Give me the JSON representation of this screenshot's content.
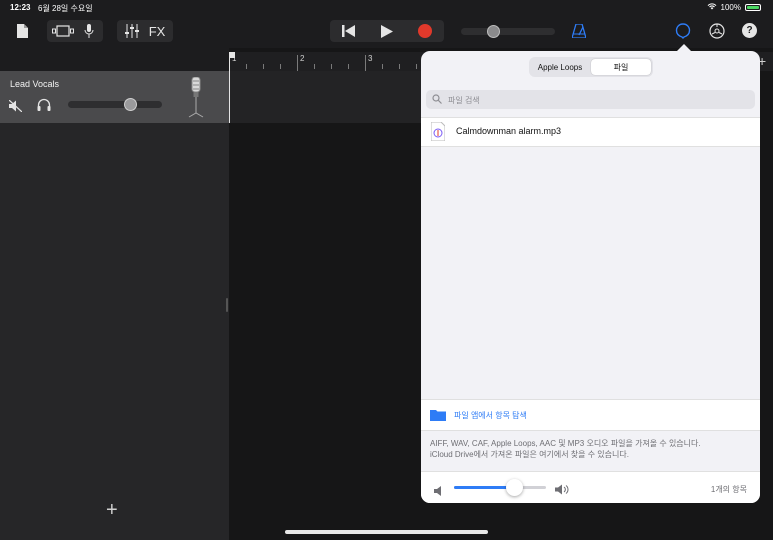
{
  "status_bar": {
    "time": "12:23",
    "date": "6월 28일 수요일",
    "battery": "100%",
    "battery_level": 1.0,
    "icons": [
      "wifi-icon",
      "battery-icon"
    ]
  },
  "toolbar": {
    "left_icons": [
      "document-icon",
      "track-view-icon",
      "microphone-icon",
      "mixer-icon"
    ],
    "fx_label": "FX",
    "transport_icons": [
      "rewind-icon",
      "play-icon",
      "record-icon"
    ],
    "master_volume_level": 0.35,
    "right_icons": [
      "metronome-icon",
      "loop-browser-icon",
      "settings-icon",
      "help-icon"
    ],
    "help_glyph": "?"
  },
  "track": {
    "name": "Lead Vocals",
    "volume_level": 0.67,
    "icons": [
      "mute-icon",
      "headphones-icon",
      "microphone-instrument-icon"
    ],
    "add_glyph": "+"
  },
  "ruler": {
    "bars": [
      "1",
      "2",
      "3"
    ],
    "add_glyph": "+"
  },
  "popover": {
    "tabs": [
      {
        "label": "Apple Loops",
        "selected": false
      },
      {
        "label": "파일",
        "selected": true
      }
    ],
    "search": {
      "placeholder": "파일 검색"
    },
    "files": [
      {
        "name": "Calmdownman alarm.mp3",
        "icon": "audio-file-icon"
      }
    ],
    "browse": {
      "label": "파일 앱에서 항목 탐색",
      "icon": "folder-icon"
    },
    "info": {
      "line1": "AIFF, WAV, CAF, Apple Loops, AAC 및 MP3 오디오 파일을 가져올 수 있습니다.",
      "line2": "iCloud Drive에서 가져온 파일은 여기에서 찾을 수 있습니다."
    },
    "preview_volume_level": 0.66,
    "count": "1개의 항목"
  },
  "colors": {
    "accent": "#2e7cf6",
    "record": "#e0392b",
    "battery": "#4cd964"
  }
}
